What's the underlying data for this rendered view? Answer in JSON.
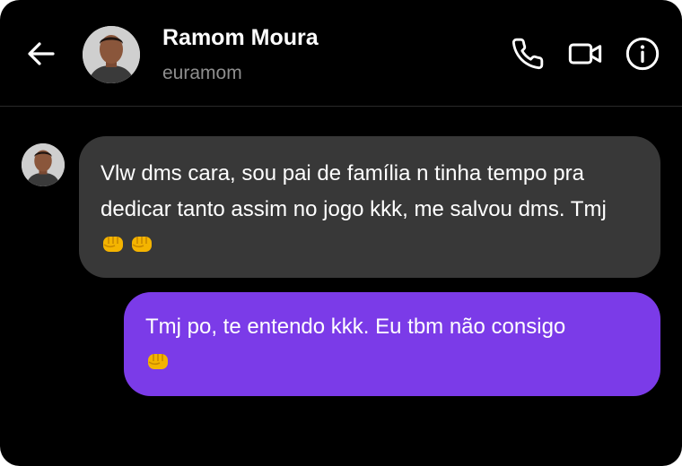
{
  "header": {
    "name": "Ramom Moura",
    "username": "euramom",
    "icons": {
      "back": "arrow-left-icon",
      "call": "phone-icon",
      "video": "video-camera-icon",
      "info": "info-circle-icon"
    }
  },
  "messages": [
    {
      "direction": "incoming",
      "text": "Vlw dms cara, sou pai de família n tinha tempo pra dedicar tanto assim no jogo kkk, me salvou dms. Tmj",
      "emoji": [
        "oncoming-fist-emoji",
        "oncoming-fist-emoji"
      ],
      "bubble_color": "#383838"
    },
    {
      "direction": "outgoing",
      "text": "Tmj po, te entendo kkk. Eu tbm não consigo",
      "emoji": [
        "oncoming-fist-emoji"
      ],
      "bubble_color": "#7b3be8"
    }
  ],
  "colors": {
    "background": "#000000",
    "accent": "#7b3be8",
    "muted_text": "#8e8e8e"
  }
}
